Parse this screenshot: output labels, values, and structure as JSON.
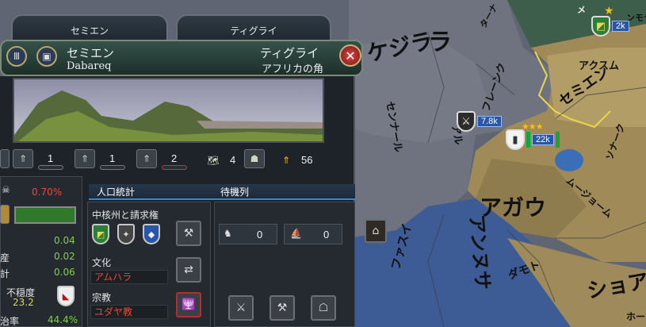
{
  "map": {
    "labels": [
      "ケジラ",
      "センナール",
      "ラ",
      "フレーンク",
      "アル",
      "ソナーク",
      "アクスム",
      "セミエン",
      "アガウ",
      "ムージョーム",
      "ダモト",
      "ショア",
      "アンヌサ",
      "ファスイ",
      "ターナ",
      "ホーク",
      "メ",
      "ンモラ"
    ],
    "units": [
      {
        "count": "7.8k",
        "stars": "",
        "icon": "sword"
      },
      {
        "count": "22k",
        "stars": "★★★",
        "icon": "crest"
      },
      {
        "count": "2k",
        "stars": "★",
        "icon": "crest"
      }
    ]
  },
  "panel": {
    "tabs": [
      "セミエン",
      "ティグライ"
    ],
    "province_name": "セミエン",
    "capital": "Dabareq",
    "state_name": "ティグライ",
    "region": "アフリカの角",
    "dev": {
      "tax": "1",
      "production": "1",
      "manpower": "2"
    },
    "trade_goods_count": "4",
    "total_dev": "56",
    "autonomy": "0.70%",
    "left_stats": [
      {
        "label": "",
        "value": "0.04"
      },
      {
        "label": "産",
        "value": "0.02"
      },
      {
        "label": "計",
        "value": "0.06"
      }
    ],
    "unrest": {
      "label": "不穏度",
      "value": "23.2"
    },
    "control": {
      "label": "治率",
      "value": "44.4%"
    },
    "subtabs": {
      "population": "人口統計",
      "queue": "待機列"
    },
    "cores_label": "中核州と請求権",
    "culture_label": "文化",
    "culture_value": "アムハラ",
    "religion_label": "宗教",
    "religion_value": "ユダヤ教",
    "queue_counts": [
      "0",
      "0"
    ]
  },
  "colors": {
    "sea": "#3d5b94",
    "land_tan": "#a48f5c",
    "land_green": "#3d5e4a",
    "land_grey": "#6a6f7b",
    "accent": "#3a86c6"
  }
}
